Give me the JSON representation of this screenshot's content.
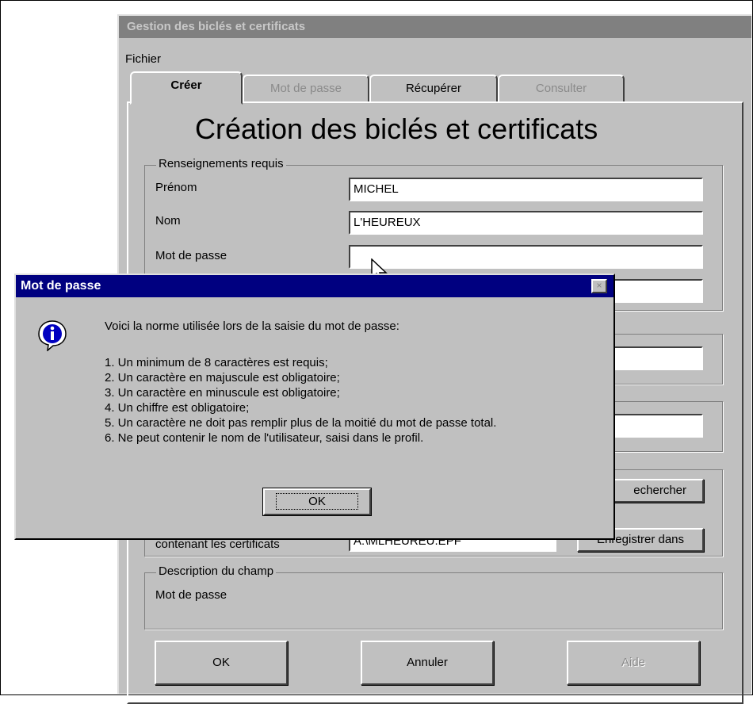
{
  "window": {
    "title": "Gestion des biclés et certificats",
    "menu": [
      "Fichier"
    ]
  },
  "tabs": [
    {
      "label": "Créer",
      "state": "active"
    },
    {
      "label": "Mot de passe",
      "state": "disabled"
    },
    {
      "label": "Récupérer",
      "state": "enabled"
    },
    {
      "label": "Consulter",
      "state": "disabled"
    }
  ],
  "page_title": "Création des biclés et certificats",
  "required_group": {
    "label": "Renseignements requis",
    "fields": [
      {
        "label": "Prénom",
        "value": "MICHEL"
      },
      {
        "label": "Nom",
        "value": "L'HEUREUX"
      },
      {
        "label": "Mot de passe",
        "value": ""
      }
    ]
  },
  "file_group": {
    "label": "contenant les certificats",
    "value": "A:\\MLHEUREU.EPF",
    "browse_button": "echercher",
    "save_button": "Enregistrer dans"
  },
  "description": {
    "label": "Description du champ",
    "text": "Mot de passe"
  },
  "footer_buttons": {
    "ok": "OK",
    "cancel": "Annuler",
    "help": "Aide"
  },
  "dialog": {
    "title": "Mot de passe",
    "close_label": "×",
    "intro": "Voici la norme utilisée lors de la saisie du mot de passe:",
    "rules": [
      "1. Un minimum de 8 caractères est requis;",
      "2. Un caractère en majuscule est obligatoire;",
      "3. Un caractère en minuscule est obligatoire;",
      "4. Un chiffre est obligatoire;",
      "5. Un caractère ne doit pas remplir plus de la moitié du mot de passe total.",
      "6. Ne peut contenir le nom de l'utilisateur, saisi dans le profil."
    ],
    "ok_label": "OK"
  }
}
